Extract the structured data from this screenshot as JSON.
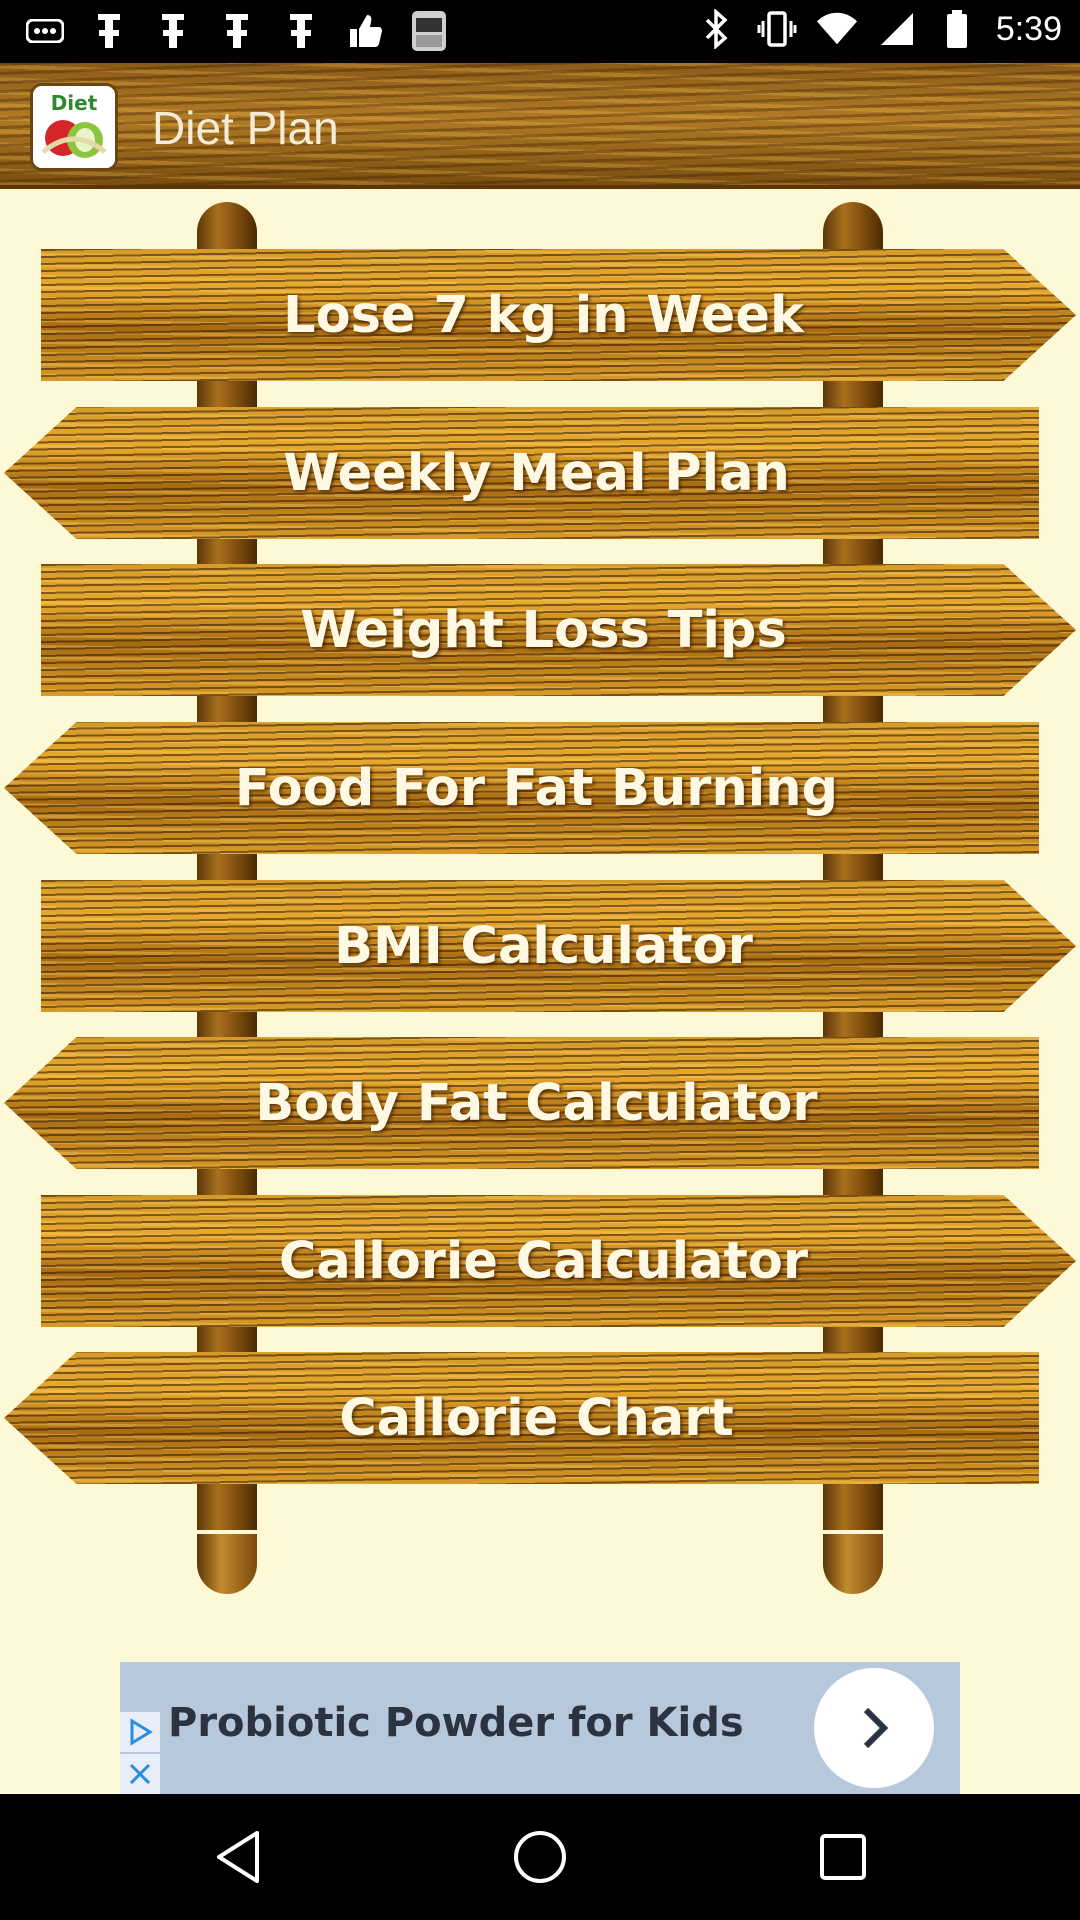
{
  "status_bar": {
    "time": "5:39",
    "left_icons": [
      "more-icon",
      "flash-icon",
      "flash-icon",
      "flash-icon",
      "flash-icon",
      "thumbs-up-icon",
      "phone-app-icon"
    ],
    "right_icons": [
      "bluetooth-icon",
      "vibrate-icon",
      "wifi-icon",
      "signal-icon",
      "battery-icon"
    ]
  },
  "app_bar": {
    "title": "Diet Plan",
    "logo_text": "Diet"
  },
  "menu": {
    "items": [
      {
        "label": "Lose 7 kg in Week",
        "direction": "right"
      },
      {
        "label": "Weekly Meal Plan",
        "direction": "left"
      },
      {
        "label": "Weight Loss Tips",
        "direction": "right"
      },
      {
        "label": "Food For Fat Burning",
        "direction": "left"
      },
      {
        "label": "BMI Calculator",
        "direction": "right"
      },
      {
        "label": "Body Fat Calculator",
        "direction": "left"
      },
      {
        "label": "Callorie Calculator",
        "direction": "right"
      },
      {
        "label": "Callorie Chart",
        "direction": "left"
      }
    ]
  },
  "ad": {
    "text": "Probiotic Powder for Kids",
    "accent": "#2a8de0"
  },
  "nav_bar": {
    "buttons": [
      "back-icon",
      "home-icon",
      "recents-icon"
    ]
  },
  "colors": {
    "background": "#fdf9d6",
    "wood": "#d59a2a",
    "wood_dark": "#7a4a0c",
    "sign_text": "#fff8e2"
  }
}
